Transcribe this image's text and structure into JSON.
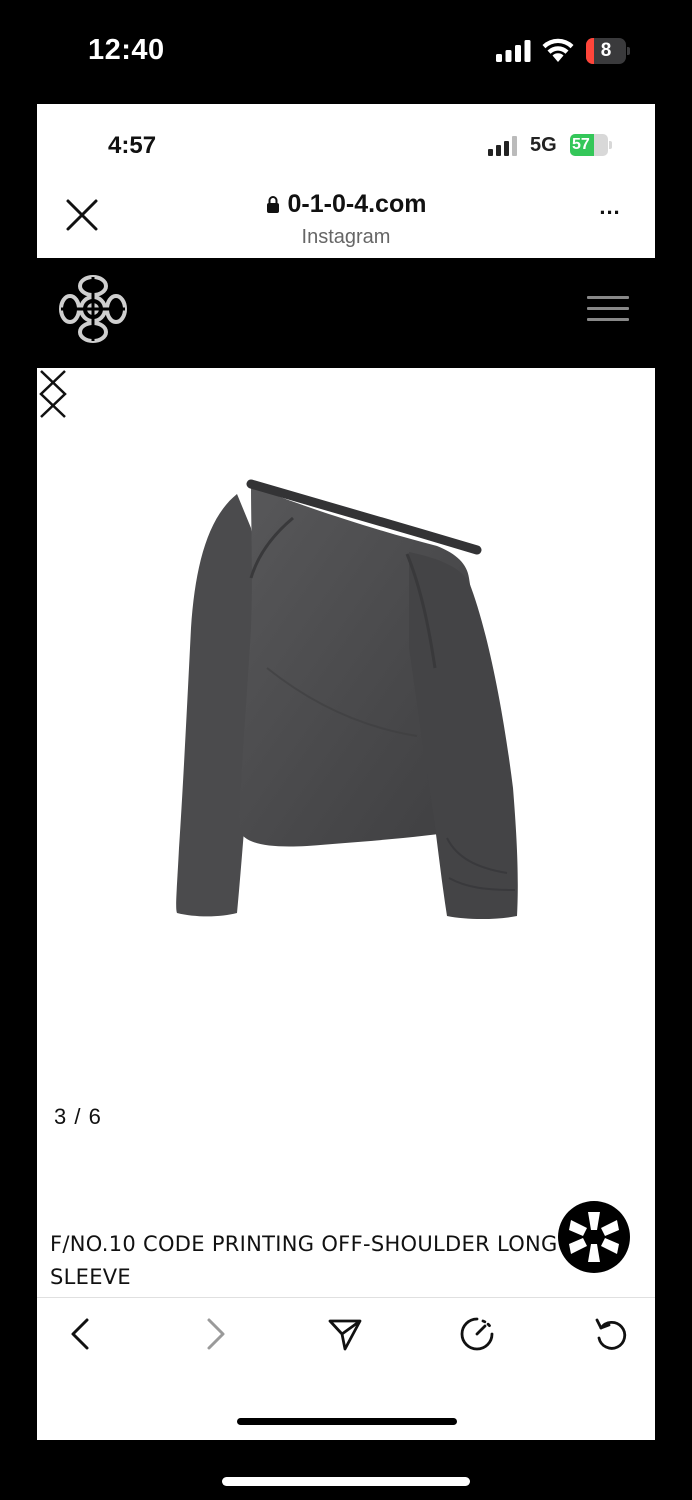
{
  "outer_status": {
    "time": "12:40",
    "battery": "8",
    "signal_icon": "cellular-signal-icon",
    "wifi_icon": "wifi-icon"
  },
  "inner_status": {
    "time": "4:57",
    "network": "5G",
    "battery": "57"
  },
  "browser": {
    "url": "0-1-0-4.com",
    "source": "Instagram",
    "more": "..."
  },
  "site": {
    "logo_icon": "brand-logo-icon",
    "menu_icon": "hamburger-menu-icon"
  },
  "gallery": {
    "counter": "3 / 6",
    "current": 3,
    "total": 6
  },
  "product": {
    "title": "F/NO.10 CODE PRINTING OFF-SHOULDER LONG SLEEVE"
  },
  "toolbar": {
    "back_icon": "chevron-left-icon",
    "forward_icon": "chevron-right-icon",
    "share_icon": "send-icon",
    "timer_icon": "timer-icon",
    "reload_icon": "reload-icon"
  },
  "colors": {
    "background": "#000000",
    "page": "#ffffff",
    "shirt": "#4a4a4c",
    "battery_low": "#ff453a",
    "battery_inner": "#34c759"
  }
}
